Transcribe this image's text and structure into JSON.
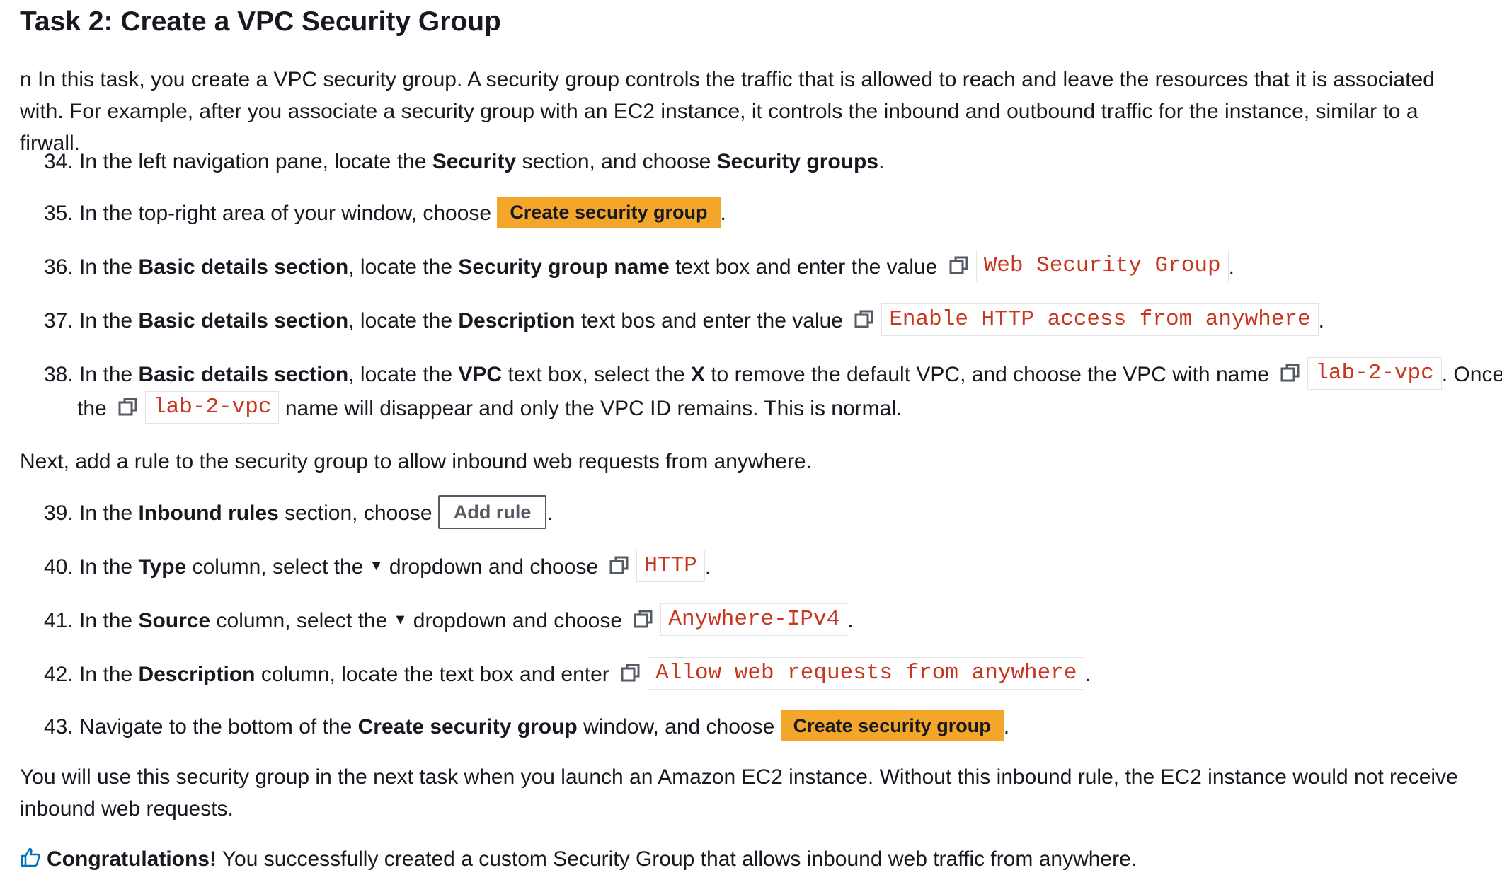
{
  "title": "Task 2: Create a VPC Security Group",
  "intro": "n In this task, you create a VPC security group. A security group controls the traffic that is allowed to reach and leave the resources that it is associated with. For example, after you associate a security group with an EC2 instance, it controls the inbound and outbound traffic for the instance, similar to a firwall.",
  "s34": {
    "num": "34.",
    "a": " In the left navigation pane, locate the ",
    "b1": "Security",
    "c": " section, and choose ",
    "b2": "Security groups",
    "d": "."
  },
  "s35": {
    "num": "35.",
    "a": " In the top-right area of your window, choose ",
    "btn": "Create security group",
    "d": "."
  },
  "s36": {
    "num": "36.",
    "a": " In the ",
    "b1": "Basic details section",
    "c": ", locate the ",
    "b2": "Security group name",
    "e": " text box and enter the value ",
    "code": "Web Security Group",
    "d": "."
  },
  "s37": {
    "num": "37.",
    "a": " In the ",
    "b1": "Basic details section",
    "c": ", locate the ",
    "b2": "Description",
    "e": " text bos and enter the value ",
    "code": "Enable HTTP access from anywhere",
    "d": "."
  },
  "s38": {
    "num": "38.",
    "a": " In the ",
    "b1": "Basic details section",
    "c": ", locate the ",
    "b2": "VPC",
    "e": " text box, select the ",
    "b3": "X",
    "f": " to remove the default VPC, and choose the VPC with name ",
    "code": "lab-2-vpc",
    "g": ". Once select,",
    "h": "the ",
    "code2": "lab-2-vpc",
    "i": " name will disappear and only the VPC ID remains. This is normal."
  },
  "next": "Next, add a rule to the security group to allow inbound web requests from anywhere.",
  "s39": {
    "num": "39.",
    "a": " In the ",
    "b1": "Inbound rules",
    "c": " section, choose ",
    "btn": "Add rule",
    "d": "."
  },
  "s40": {
    "num": "40.",
    "a": " In the ",
    "b1": "Type",
    "c": " column, select the ",
    "e": " dropdown and choose ",
    "code": "HTTP",
    "d": "."
  },
  "s41": {
    "num": "41.",
    "a": " In the ",
    "b1": "Source",
    "c": " column, select the ",
    "e": " dropdown and choose ",
    "code": "Anywhere-IPv4",
    "d": "."
  },
  "s42": {
    "num": "42.",
    "a": " In the ",
    "b1": "Description",
    "c": " column, locate the text box and enter ",
    "code": "Allow web requests from anywhere",
    "d": "."
  },
  "s43": {
    "num": "43.",
    "a": " Navigate to the bottom of the ",
    "b1": "Create security group",
    "c": " window, and choose ",
    "btn": "Create security group",
    "d": "."
  },
  "outro": "You will use this security group in the next task when you launch an Amazon EC2 instance. Without this inbound rule, the EC2 instance would not receive inbound web requests.",
  "congrats": {
    "bold": "Congratulations!",
    "text": " You successfully created a custom Security Group that allows inbound web traffic from anywhere."
  },
  "icons": {
    "copy": "copy-icon",
    "caret": "caret-down-icon",
    "thumb": "thumbs-up-icon"
  },
  "colors": {
    "accent_button": "#f4a62a",
    "code_text": "#c7361f",
    "outline_button": "#545b64"
  }
}
